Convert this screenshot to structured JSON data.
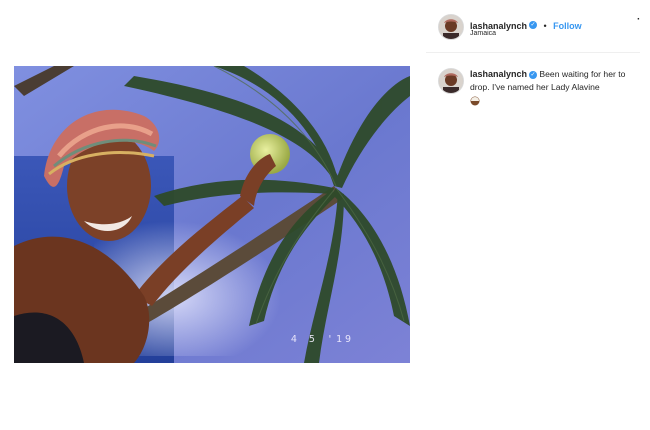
{
  "post": {
    "date_stamp": "4 5 '19"
  },
  "header": {
    "username": "lashanalynch",
    "verified_icon": "verified-badge-icon",
    "separator": "•",
    "follow_label": "Follow",
    "location": "Jamaica",
    "more_label": "·"
  },
  "caption": {
    "username": "lashanalynch",
    "text": "Been waiting for her to drop. I've named her Lady Alavine",
    "emoji_icon": "coconut-emoji-icon"
  },
  "colors": {
    "link_blue": "#3897f0",
    "text": "#262626",
    "divider": "#efefef"
  }
}
